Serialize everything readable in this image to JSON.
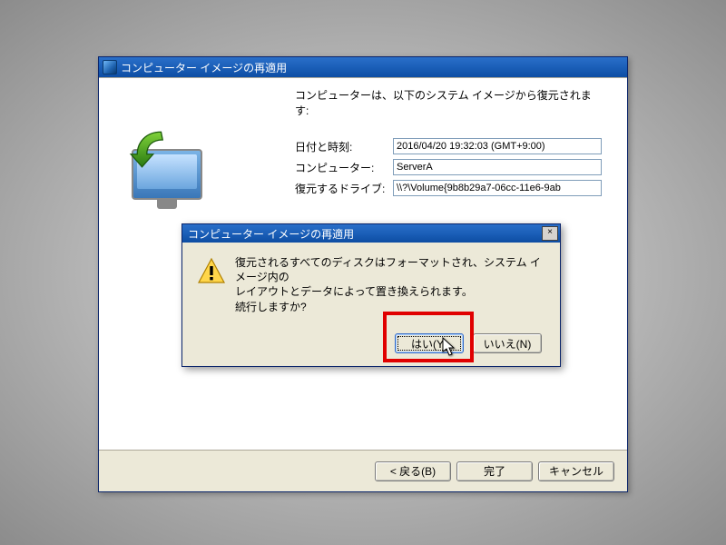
{
  "wizard": {
    "title": "コンピューター イメージの再適用",
    "intro": "コンピューターは、以下のシステム イメージから復元されます:",
    "rows": {
      "datetime_label": "日付と時刻:",
      "datetime_value": "2016/04/20 19:32:03 (GMT+9:00)",
      "computer_label": "コンピューター:",
      "computer_value": "ServerA",
      "drives_label": "復元するドライブ:",
      "drives_value": "\\\\?\\Volume{9b8b29a7-06cc-11e6-9ab"
    },
    "buttons": {
      "back": "< 戻る(B)",
      "finish": "完了",
      "cancel": "キャンセル"
    }
  },
  "dialog": {
    "title": "コンピューター イメージの再適用",
    "message_l1": "復元されるすべてのディスクはフォーマットされ、システム イメージ内の",
    "message_l2": "レイアウトとデータによって置き換えられます。",
    "message_l3": "続行しますか?",
    "yes": "はい(Y)",
    "no": "いいえ(N)",
    "close": "×"
  }
}
